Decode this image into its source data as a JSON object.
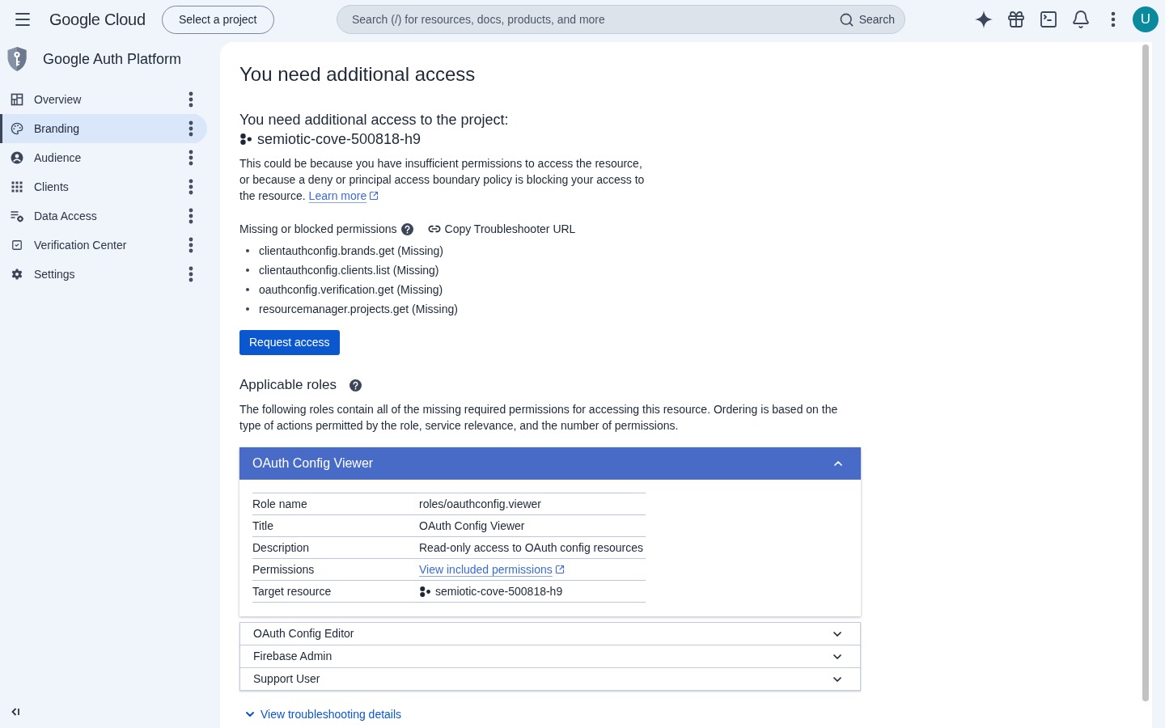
{
  "top_bar": {
    "product_name": "Google Cloud",
    "project_picker": "Select a project",
    "search": {
      "placeholder": "Search (/) for resources, docs, products, and more",
      "button": "Search"
    },
    "avatar": "U"
  },
  "sidebar": {
    "title": "Google Auth Platform",
    "items": [
      {
        "label": "Overview",
        "selected": false
      },
      {
        "label": "Branding",
        "selected": true
      },
      {
        "label": "Audience",
        "selected": false
      },
      {
        "label": "Clients",
        "selected": false
      },
      {
        "label": "Data Access",
        "selected": false
      },
      {
        "label": "Verification Center",
        "selected": false
      },
      {
        "label": "Settings",
        "selected": false
      }
    ]
  },
  "page": {
    "title": "You need additional access",
    "subtitle": "You need additional access to the project:",
    "project": "semiotic-cove-500818-h9",
    "explanation": "This could be because you have insufficient permissions to access the resource, or because a deny or principal access boundary policy is blocking your access to the resource.",
    "learn_more": "Learn more",
    "permissions": {
      "heading": "Missing or blocked permissions",
      "copy_link": "Copy Troubleshooter URL",
      "items": [
        "clientauthconfig.brands.get (Missing)",
        "clientauthconfig.clients.list (Missing)",
        "oauthconfig.verification.get (Missing)",
        "resourcemanager.projects.get (Missing)"
      ]
    },
    "request_button": "Request access",
    "roles": {
      "heading": "Applicable roles",
      "description": "The following roles contain all of the missing required permissions for accessing this resource. Ordering is based on the type of actions permitted by the role, service relevance, and the number of permissions.",
      "items": [
        {
          "name": "OAuth Config Viewer",
          "expanded": true,
          "details": [
            {
              "kind": "text",
              "label": "Role name",
              "value": "roles/oauthconfig.viewer"
            },
            {
              "kind": "text",
              "label": "Title",
              "value": "OAuth Config Viewer"
            },
            {
              "kind": "text",
              "label": "Description",
              "value": "Read-only access to OAuth config resources"
            },
            {
              "kind": "link",
              "label": "Permissions",
              "value": "View included permissions"
            },
            {
              "kind": "resource",
              "label": "Target resource",
              "value": "semiotic-cove-500818-h9"
            }
          ]
        },
        {
          "name": "OAuth Config Editor",
          "expanded": false
        },
        {
          "name": "Firebase Admin",
          "expanded": false
        },
        {
          "name": "Support User",
          "expanded": false
        }
      ]
    },
    "troubleshooting_link": "View troubleshooting details"
  }
}
